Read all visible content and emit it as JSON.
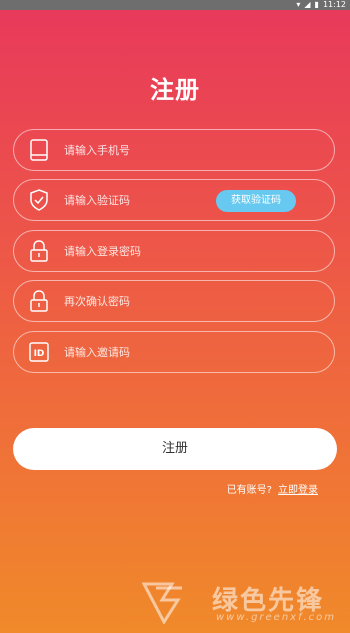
{
  "status_bar": {
    "time": "11:12"
  },
  "page": {
    "title": "注册"
  },
  "fields": [
    {
      "icon": "phone-icon",
      "placeholder": "请输入手机号"
    },
    {
      "icon": "shield-check-icon",
      "placeholder": "请输入验证码",
      "button": "获取验证码"
    },
    {
      "icon": "lock-icon",
      "placeholder": "请输入登录密码"
    },
    {
      "icon": "lock-icon",
      "placeholder": "再次确认密码"
    },
    {
      "icon": "id-icon",
      "placeholder": "请输入邀请码"
    }
  ],
  "submit": {
    "label": "注册"
  },
  "footer": {
    "prompt": "已有账号?",
    "login_link": "立即登录"
  },
  "watermark": {
    "name": "绿色先锋",
    "url": "www.greenxf.com"
  },
  "colors": {
    "gradient_top": "#e8385c",
    "gradient_bottom": "#f08a2a",
    "code_button": "#67c9f0"
  }
}
